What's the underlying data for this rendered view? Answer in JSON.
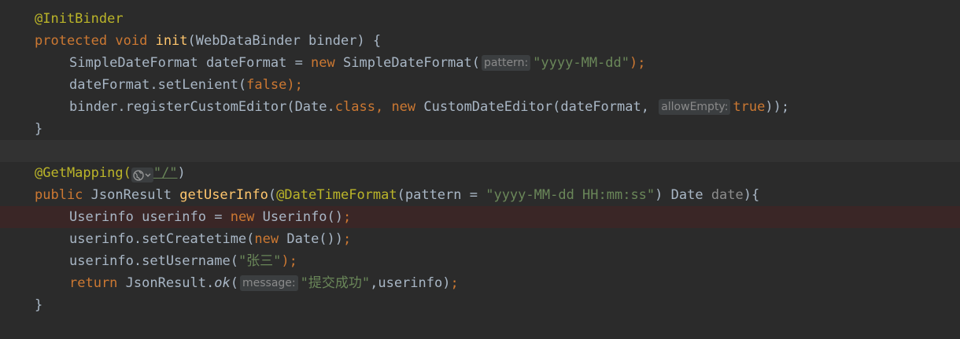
{
  "code": {
    "l1": {
      "annotation": "@InitBinder"
    },
    "l2": {
      "kw_protected": "protected",
      "kw_void": "void",
      "fn": "init",
      "rest": "(WebDataBinder binder) {"
    },
    "l3": {
      "type": "SimpleDateFormat dateFormat = ",
      "kw_new": "new",
      "ctor": " SimpleDateFormat(",
      "hint": "pattern:",
      "str": "\"yyyy-MM-dd\"",
      "end": ");"
    },
    "l4": {
      "call": "dateFormat.setLenient(",
      "kw_false": "false",
      "end": ");"
    },
    "l5": {
      "call": "binder.registerCustomEditor(Date.",
      "kw_class": "class",
      "comma": ", ",
      "kw_new": "new",
      "ctor": " CustomDateEditor(dateFormat, ",
      "hint": "allowEmpty:",
      "kw_true": "true",
      "end": "));"
    },
    "l6": {
      "brace": "}"
    },
    "l8": {
      "annotation": "@GetMapping(",
      "path": "\"/\"",
      "close": ")"
    },
    "l9": {
      "kw_public": "public",
      "type": " JsonResult ",
      "fn": "getUserInfo",
      "open": "(",
      "annotation": "@DateTimeFormat",
      "args": "(pattern = ",
      "str": "\"yyyy-MM-dd HH:mm:ss\"",
      "after": ") Date ",
      "param": "date",
      "end": "){"
    },
    "l10": {
      "decl": "Userinfo userinfo = ",
      "kw_new": "new",
      "ctor": " Userinfo()",
      "end": ";"
    },
    "l11": {
      "call": "userinfo.setCreatetime(",
      "kw_new": "new",
      "ctor": " Date())",
      "end": ";"
    },
    "l12": {
      "call": "userinfo.setUsername(",
      "str": "\"张三\"",
      "end": ");"
    },
    "l13": {
      "kw_return": "return",
      "cls": " JsonResult.",
      "method": "ok",
      "open": "(",
      "hint": "message:",
      "str": "\"提交成功\"",
      "args": ",userinfo)",
      "end": ";"
    },
    "l14": {
      "brace": "}"
    }
  },
  "icons": {
    "mapping": "globe-icon",
    "dropdown": "chevron-down-icon"
  },
  "colors": {
    "background": "#2b2b2b",
    "keyword": "#cc7832",
    "annotation": "#bbb529",
    "function": "#ffc66d",
    "string": "#6a8759",
    "text": "#a9b7c6"
  }
}
